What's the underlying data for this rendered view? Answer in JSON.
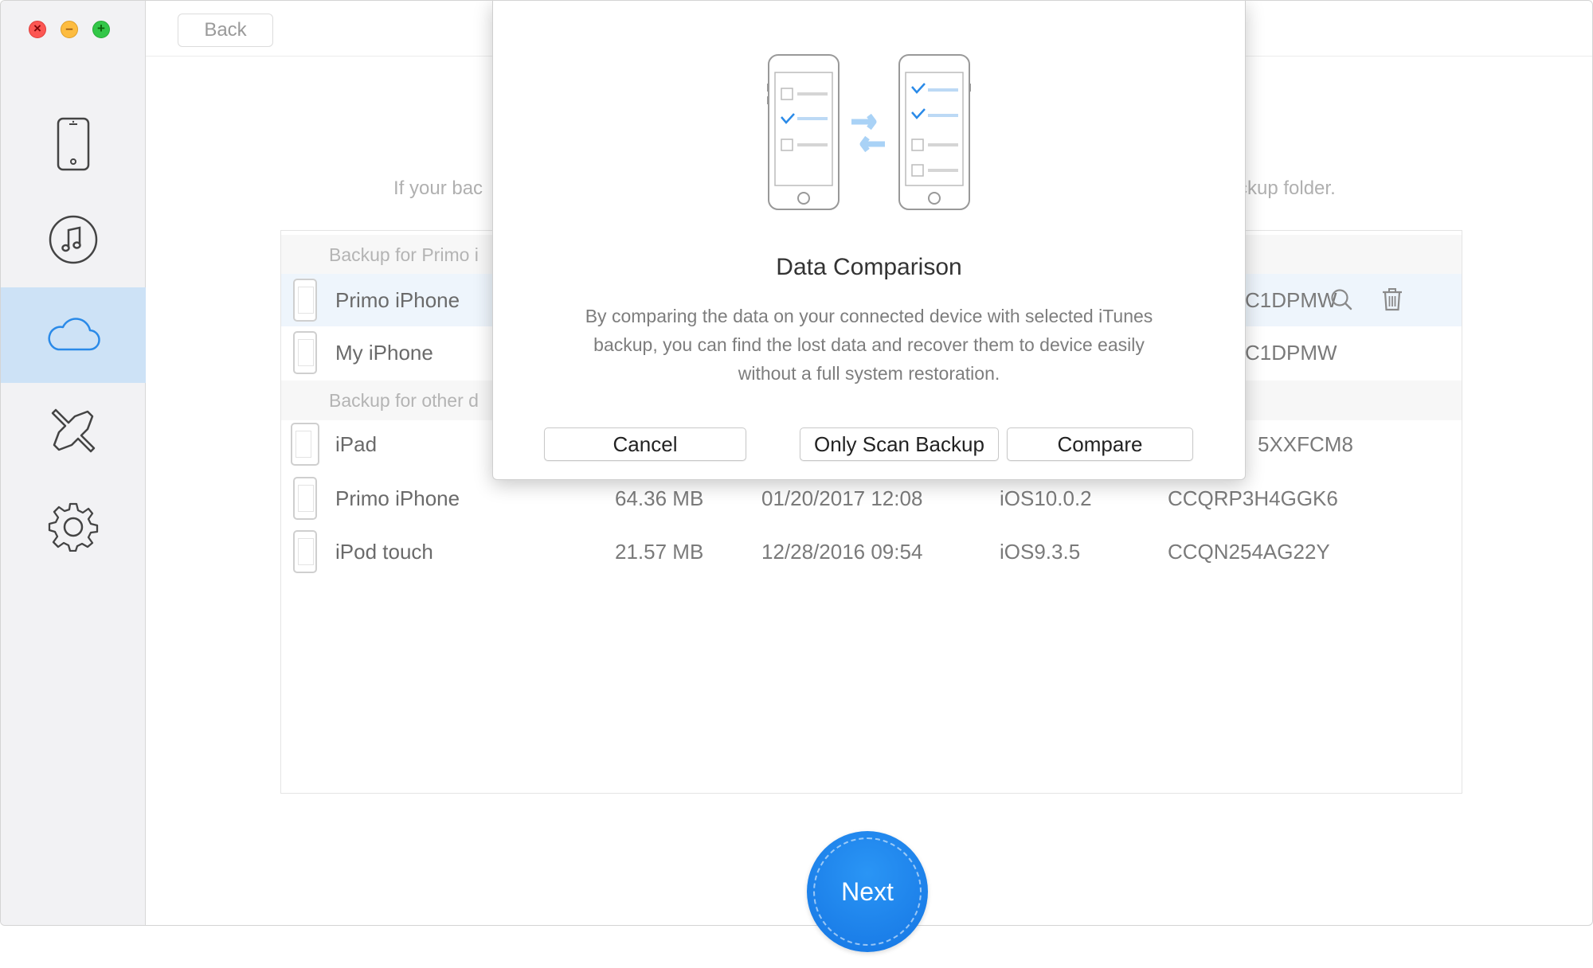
{
  "window": {
    "controls": {
      "close_glyph": "×",
      "min_glyph": "–",
      "max_glyph": "+"
    }
  },
  "sidebar": {
    "items": [
      {
        "icon": "phone-icon",
        "active": false
      },
      {
        "icon": "music-icon",
        "active": false
      },
      {
        "icon": "cloud-icon",
        "active": true
      },
      {
        "icon": "tools-icon",
        "active": false
      },
      {
        "icon": "gear-icon",
        "active": false
      }
    ],
    "accent_color": "#cde2f6"
  },
  "toolbar": {
    "back_label": "Back"
  },
  "main": {
    "hint_left": "If your bac",
    "hint_right": "ckup folder."
  },
  "table": {
    "groups": [
      {
        "header": "Backup for Primo i",
        "rows": [
          {
            "name": "Primo iPhone",
            "serial": "C1DPMW",
            "selected": true
          },
          {
            "name": "My iPhone",
            "serial": "C1DPMW",
            "selected": false
          }
        ]
      },
      {
        "header": "Backup for other d",
        "rows": [
          {
            "name": "iPad",
            "size": "",
            "date": "",
            "ios": "",
            "serial": "5XXFCM8"
          },
          {
            "name": "Primo iPhone",
            "size": "64.36 MB",
            "date": "01/20/2017 12:08",
            "ios": "iOS10.0.2",
            "serial": "CCQRP3H4GGK6"
          },
          {
            "name": "iPod touch",
            "size": "21.57 MB",
            "date": "12/28/2016 09:54",
            "ios": "iOS9.3.5",
            "serial": "CCQN254AG22Y"
          }
        ]
      }
    ]
  },
  "next_button": {
    "label": "Next",
    "color": "#1a7fe8"
  },
  "modal": {
    "title": "Data Comparison",
    "message": "By comparing the data on your connected device with selected iTunes backup, you can find the lost data and recover them to device easily without a full system restoration.",
    "buttons": {
      "cancel": "Cancel",
      "scan": "Only Scan Backup",
      "compare": "Compare"
    },
    "illustration_icon": "phone-compare-icon"
  }
}
